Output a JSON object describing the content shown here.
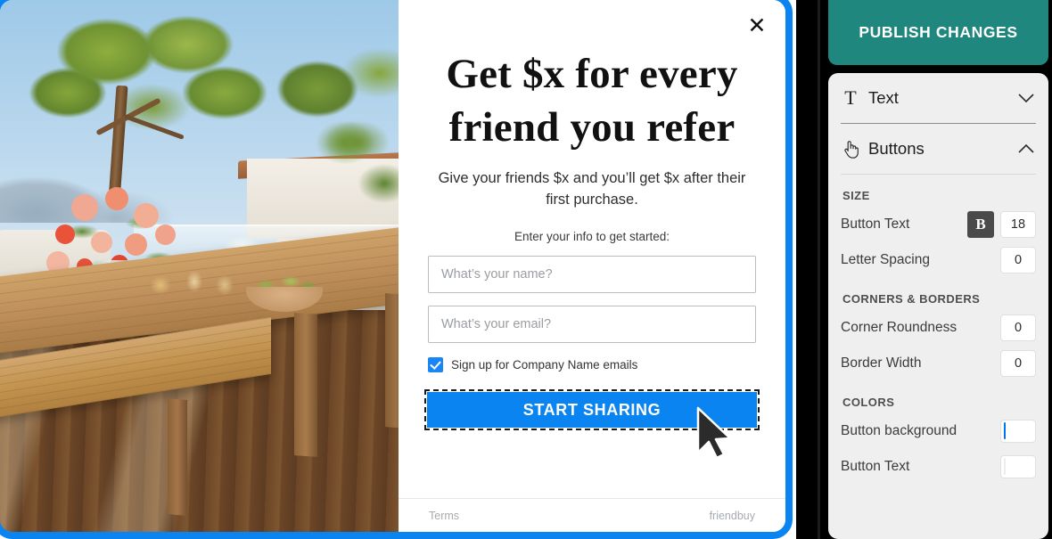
{
  "popup": {
    "close_icon": "close-icon",
    "headline": "Get $x for every friend you refer",
    "subhead": "Give your friends $x and you’ll get $x after their first purchase.",
    "prompt": "Enter your info to get started:",
    "name_placeholder": "What’s your name?",
    "name_value": "",
    "email_placeholder": "What’s your email?",
    "email_value": "",
    "checkbox_label": "Sign up for Company Name emails",
    "checkbox_checked": true,
    "cta_label": "START SHARING",
    "footer_terms": "Terms",
    "footer_brand": "friendbuy",
    "border_color": "#0A84F0",
    "cta_color": "#0A84F0"
  },
  "editor": {
    "publish_label": "PUBLISH CHANGES",
    "publish_color": "#1F877E",
    "sections": [
      {
        "label": "Text",
        "icon": "serif-t-icon",
        "expanded": false,
        "chevron": "chevron-down-icon"
      },
      {
        "label": "Buttons",
        "icon": "pointing-hand-icon",
        "expanded": true,
        "chevron": "chevron-up-icon"
      }
    ],
    "groups": [
      {
        "label": "SIZE",
        "rows": [
          {
            "label": "Button Text",
            "bold_toggle": "B",
            "bold_active": true,
            "value": "18"
          },
          {
            "label": "Letter Spacing",
            "value": "0"
          }
        ]
      },
      {
        "label": "CORNERS & BORDERS",
        "rows": [
          {
            "label": "Corner Roundness",
            "value": "0"
          },
          {
            "label": "Border Width",
            "value": "0"
          }
        ]
      },
      {
        "label": "COLORS",
        "rows": [
          {
            "label": "Button background",
            "swatch": "#007FFF"
          },
          {
            "label": "Button Text",
            "swatch": "#FFFFFF"
          }
        ]
      }
    ]
  }
}
